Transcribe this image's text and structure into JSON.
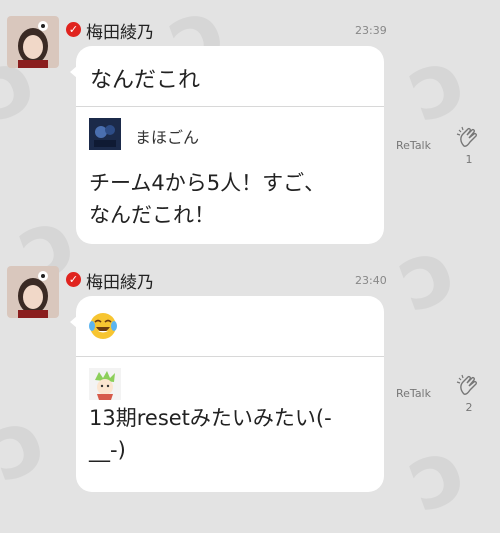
{
  "posts": [
    {
      "author": "梅田綾乃",
      "time": "23:39",
      "message": "なんだこれ",
      "quote": {
        "author": "まほごん",
        "text_line1": "チーム4から5人！すご、",
        "text_line2": "なんだこれ！"
      },
      "retalk_label": "ReTalk",
      "clap_count": "1"
    },
    {
      "author": "梅田綾乃",
      "time": "23:40",
      "message_icon": "tears-of-joy-emoji",
      "quote": {
        "author": "",
        "text_line1": "13期resetみたいみたい(-",
        "text_line2": "__-)"
      },
      "retalk_label": "ReTalk",
      "clap_count": "2"
    }
  ],
  "colors": {
    "background": "#e3e3e3",
    "bubble": "#ffffff",
    "verified": "#e0231e"
  }
}
